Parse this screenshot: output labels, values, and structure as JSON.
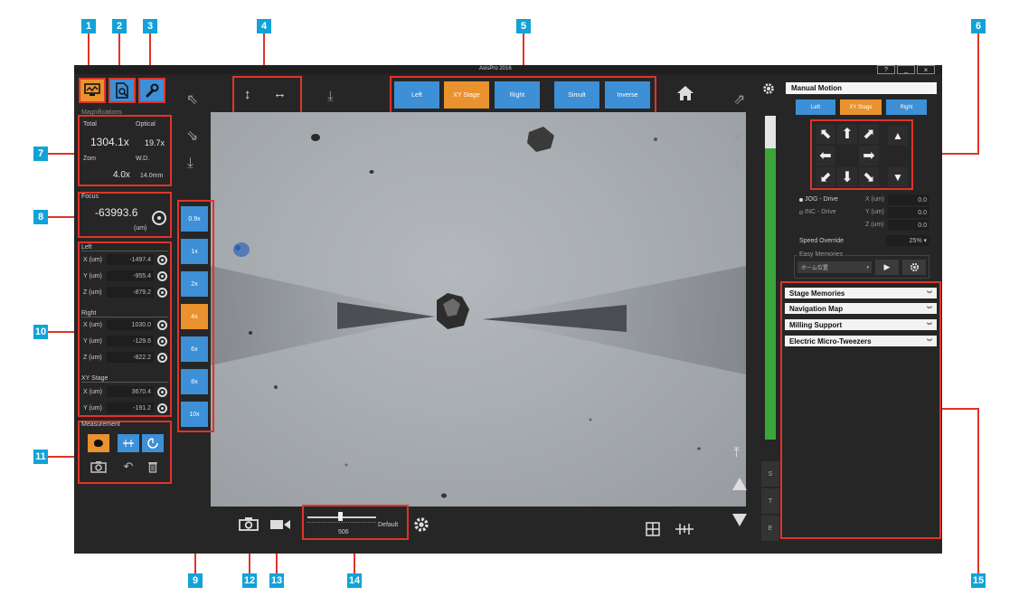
{
  "callouts": [
    "1",
    "2",
    "3",
    "4",
    "5",
    "6",
    "7",
    "8",
    "9",
    "10",
    "11",
    "12",
    "13",
    "14",
    "15"
  ],
  "window": {
    "title": "AxisPro 2016",
    "help": "?",
    "minimize": "_",
    "close": "×"
  },
  "top_toggle": [
    "Left",
    "XY Stage",
    "Right",
    "Simult",
    "Inverse"
  ],
  "magnifications": {
    "title": "Magnifications",
    "total_label": "Total",
    "optical_label": "Optical",
    "total_value": "1304.1x",
    "optical_value": "19.7x",
    "zoom_label": "Zom",
    "wd_label": "W.D.",
    "zoom_value": "4.0x",
    "wd_value": "14.0mm"
  },
  "focus": {
    "title": "Focus",
    "value": "-63993.6",
    "unit": "(um)"
  },
  "mag_buttons": [
    "0.9x",
    "1x",
    "2x",
    "4x",
    "6x",
    "8x",
    "10x"
  ],
  "positions": {
    "left": {
      "title": "Left",
      "rows": [
        {
          "label": "X (um)",
          "value": "-1497.4"
        },
        {
          "label": "Y (um)",
          "value": "-955.4"
        },
        {
          "label": "Z (um)",
          "value": "-879.2"
        }
      ]
    },
    "right": {
      "title": "Right",
      "rows": [
        {
          "label": "X (um)",
          "value": "1030.0"
        },
        {
          "label": "Y (um)",
          "value": "-129.6"
        },
        {
          "label": "Z (um)",
          "value": "-822.2"
        }
      ]
    },
    "xy": {
      "title": "XY Stage",
      "rows": [
        {
          "label": "X (um)",
          "value": "3670.4"
        },
        {
          "label": "Y (um)",
          "value": "-191.2"
        }
      ]
    }
  },
  "measurement": {
    "title": "Measurement"
  },
  "bottom": {
    "slider_value": "506",
    "default_label": "Default"
  },
  "manual_motion": {
    "title": "Manual Motion",
    "tabs": [
      "Left",
      "XY Stage",
      "Right"
    ],
    "jog_label": "JOG - Drive",
    "inc_label": "INC - Drive",
    "fields": [
      {
        "label": "X (um)",
        "value": "0.0"
      },
      {
        "label": "Y (um)",
        "value": "0.0"
      },
      {
        "label": "Z (um)",
        "value": "0.0"
      }
    ],
    "speed_label": "Speed Override",
    "speed_value": "25% ▾",
    "easy_label": "Easy Memories",
    "easy_value": "ホーム位置"
  },
  "side_tabs": [
    "S",
    "T",
    "E"
  ],
  "sections": [
    "Stage Memories",
    "Navigation Map",
    "Milling Support",
    "Electric Micro-Tweezers"
  ],
  "colors": {
    "accent_blue": "#3d8fd6",
    "accent_orange": "#e9922e",
    "callout": "#12a2d8",
    "highlight": "#e0342a",
    "level_green": "#3aa63a"
  },
  "level_meter": {
    "fill_fraction": 0.9
  }
}
